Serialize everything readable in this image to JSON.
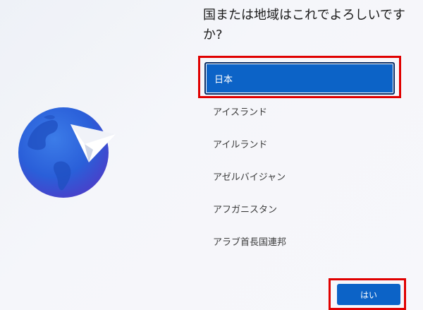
{
  "question": "国または地域はこれでよろしいですか?",
  "countries": [
    {
      "label": "日本",
      "selected": true
    },
    {
      "label": "アイスランド",
      "selected": false
    },
    {
      "label": "アイルランド",
      "selected": false
    },
    {
      "label": "アゼルバイジャン",
      "selected": false
    },
    {
      "label": "アフガニスタン",
      "selected": false
    },
    {
      "label": "アラブ首長国連邦",
      "selected": false
    }
  ],
  "yes_button": {
    "label": "はい"
  },
  "colors": {
    "accent": "#0c63c7",
    "highlight": "#e00000",
    "globe": "#2a5fd9"
  },
  "illustration": {
    "icon": "globe-with-paper-plane-icon"
  }
}
